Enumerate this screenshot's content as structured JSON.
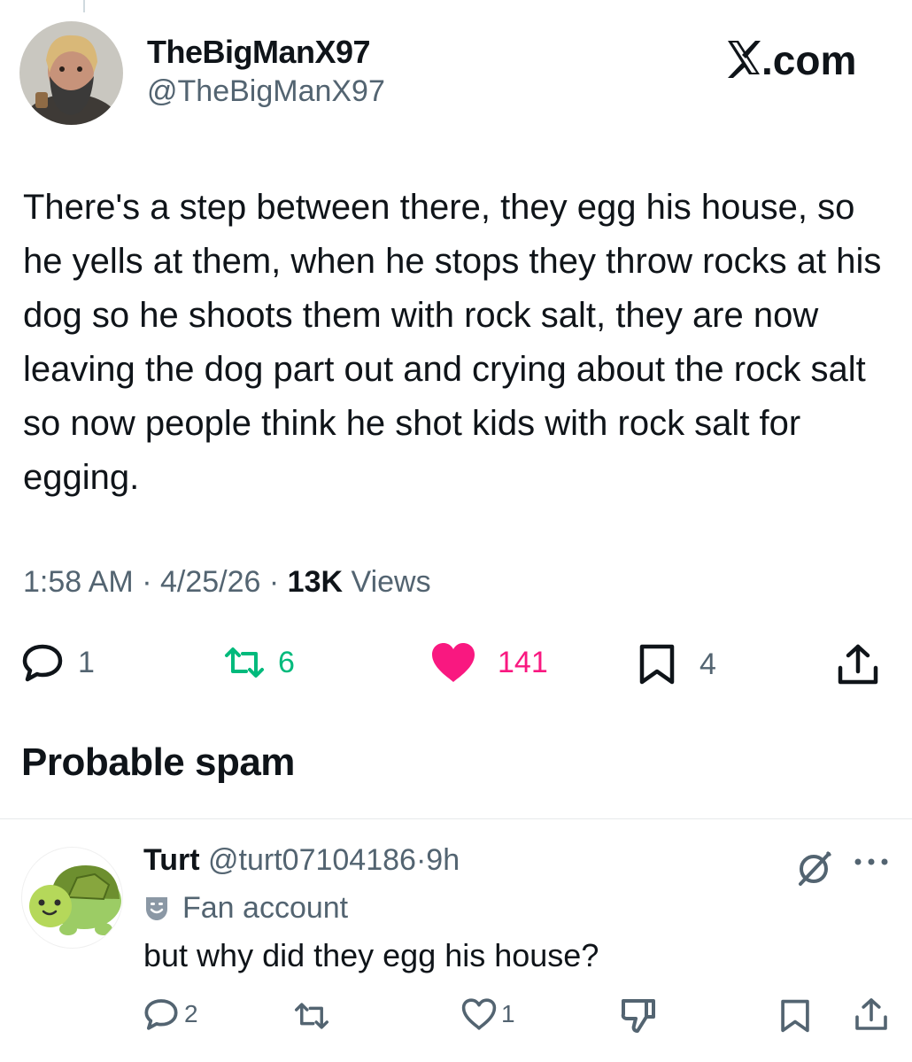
{
  "tweet": {
    "display_name": "TheBigManX97",
    "handle": "@TheBigManX97",
    "site_logo": "X.com",
    "text": "There's a step between there, they egg his house, so he yells at them, when he stops they throw rocks at his dog so he shoots them with rock salt, they are now leaving the dog part out and crying about the rock salt so now people think he shot kids with rock salt for egging.",
    "time": "1:58 AM",
    "date": "4/25/26",
    "separator": "·",
    "views_count": "13K",
    "views_label": "Views",
    "actions": {
      "replies": "1",
      "reposts": "6",
      "likes": "141",
      "bookmarks": "4"
    }
  },
  "section": {
    "title": "Probable spam"
  },
  "reply": {
    "display_name": "Turt",
    "handle": "@turt07104186",
    "separator": "·",
    "age": "9h",
    "badge_label": "Fan account",
    "text": "but why did they egg his house?",
    "actions": {
      "replies": "2",
      "likes": "1"
    }
  },
  "colors": {
    "text_primary": "#0f1419",
    "text_secondary": "#536471",
    "repost_active": "#00ba7c",
    "like_active": "#f91880"
  },
  "icons": [
    "reply-icon",
    "repost-icon",
    "heart-icon",
    "bookmark-icon",
    "share-icon",
    "grok-icon",
    "more-icon",
    "theater-masks-icon",
    "thumbs-down-icon"
  ]
}
